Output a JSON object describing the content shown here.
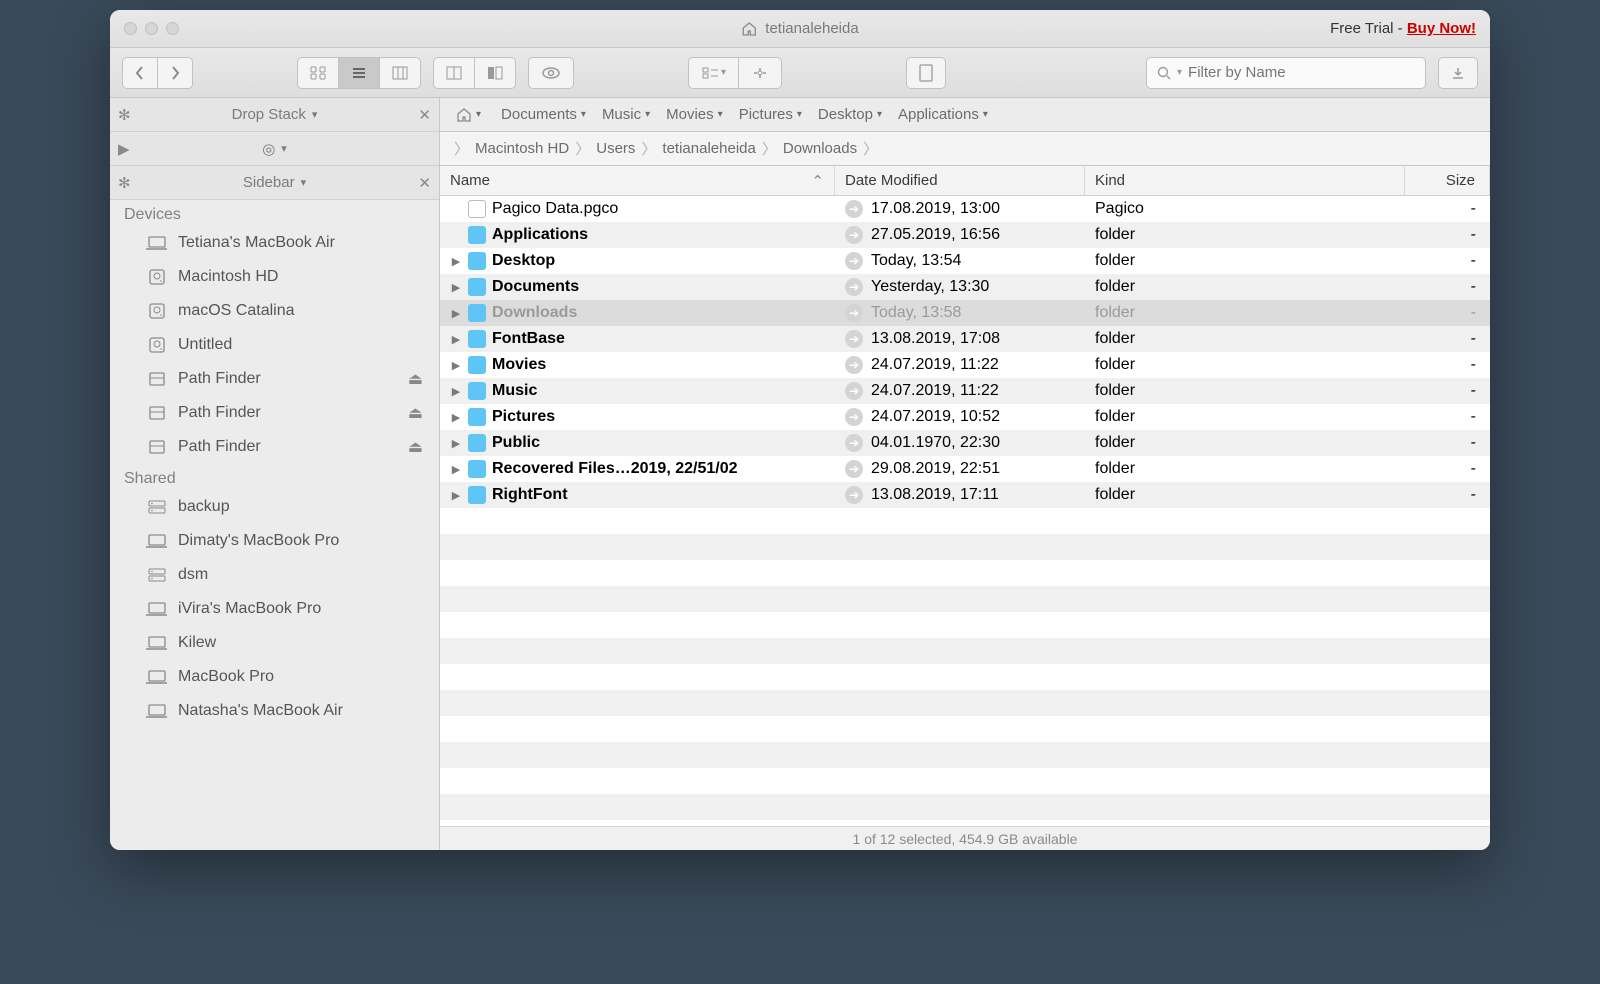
{
  "title": "tetianaleheida",
  "trial_prefix": "Free Trial - ",
  "trial_link": "Buy Now!",
  "search_placeholder": "Filter by Name",
  "drop_stack_label": "Drop Stack",
  "sidebar_label": "Sidebar",
  "bookmarks": [
    "Documents",
    "Music",
    "Movies",
    "Pictures",
    "Desktop",
    "Applications"
  ],
  "breadcrumb": [
    "Macintosh HD",
    "Users",
    "tetianaleheida",
    "Downloads"
  ],
  "columns": {
    "name": "Name",
    "date": "Date Modified",
    "kind": "Kind",
    "size": "Size"
  },
  "devices_label": "Devices",
  "shared_label": "Shared",
  "devices": [
    {
      "label": "Tetiana's MacBook Air",
      "icon": "laptop"
    },
    {
      "label": "Macintosh HD",
      "icon": "hdd"
    },
    {
      "label": "macOS Catalina",
      "icon": "hdd"
    },
    {
      "label": "Untitled",
      "icon": "hdd"
    },
    {
      "label": "Path Finder",
      "icon": "disk",
      "eject": true
    },
    {
      "label": "Path Finder",
      "icon": "disk",
      "eject": true
    },
    {
      "label": "Path Finder",
      "icon": "disk",
      "eject": true
    }
  ],
  "shared": [
    {
      "label": "backup",
      "icon": "server"
    },
    {
      "label": "Dimaty's MacBook Pro",
      "icon": "laptop"
    },
    {
      "label": "dsm",
      "icon": "server"
    },
    {
      "label": "iVira's MacBook Pro",
      "icon": "laptop"
    },
    {
      "label": "Kilew",
      "icon": "laptop"
    },
    {
      "label": "MacBook Pro",
      "icon": "laptop"
    },
    {
      "label": "Natasha's MacBook Air",
      "icon": "laptop"
    }
  ],
  "files": [
    {
      "name": "Pagico Data.pgco",
      "date": "17.08.2019, 13:00",
      "kind": "Pagico",
      "icon": "doc",
      "expandable": false,
      "bold": false,
      "selected": false
    },
    {
      "name": "Applications",
      "date": "27.05.2019, 16:56",
      "kind": "folder",
      "icon": "folder",
      "expandable": false,
      "bold": true,
      "selected": false
    },
    {
      "name": "Desktop",
      "date": "Today, 13:54",
      "kind": "folder",
      "icon": "folder",
      "expandable": true,
      "bold": true,
      "selected": false
    },
    {
      "name": "Documents",
      "date": "Yesterday, 13:30",
      "kind": "folder",
      "icon": "folder",
      "expandable": true,
      "bold": true,
      "selected": false
    },
    {
      "name": "Downloads",
      "date": "Today, 13:58",
      "kind": "folder",
      "icon": "folder",
      "expandable": true,
      "bold": true,
      "selected": true
    },
    {
      "name": "FontBase",
      "date": "13.08.2019, 17:08",
      "kind": "folder",
      "icon": "folder",
      "expandable": true,
      "bold": true,
      "selected": false
    },
    {
      "name": "Movies",
      "date": "24.07.2019, 11:22",
      "kind": "folder",
      "icon": "folder",
      "expandable": true,
      "bold": true,
      "selected": false
    },
    {
      "name": "Music",
      "date": "24.07.2019, 11:22",
      "kind": "folder",
      "icon": "folder",
      "expandable": true,
      "bold": true,
      "selected": false
    },
    {
      "name": "Pictures",
      "date": "24.07.2019, 10:52",
      "kind": "folder",
      "icon": "folder",
      "expandable": true,
      "bold": true,
      "selected": false
    },
    {
      "name": "Public",
      "date": "04.01.1970, 22:30",
      "kind": "folder",
      "icon": "folder",
      "expandable": true,
      "bold": true,
      "selected": false
    },
    {
      "name": "Recovered Files…2019, 22/51/02",
      "date": "29.08.2019, 22:51",
      "kind": "folder",
      "icon": "folder",
      "expandable": true,
      "bold": true,
      "selected": false
    },
    {
      "name": "RightFont",
      "date": "13.08.2019, 17:11",
      "kind": "folder",
      "icon": "folder",
      "expandable": true,
      "bold": true,
      "selected": false
    }
  ],
  "status": "1 of 12 selected, 454.9 GB available"
}
